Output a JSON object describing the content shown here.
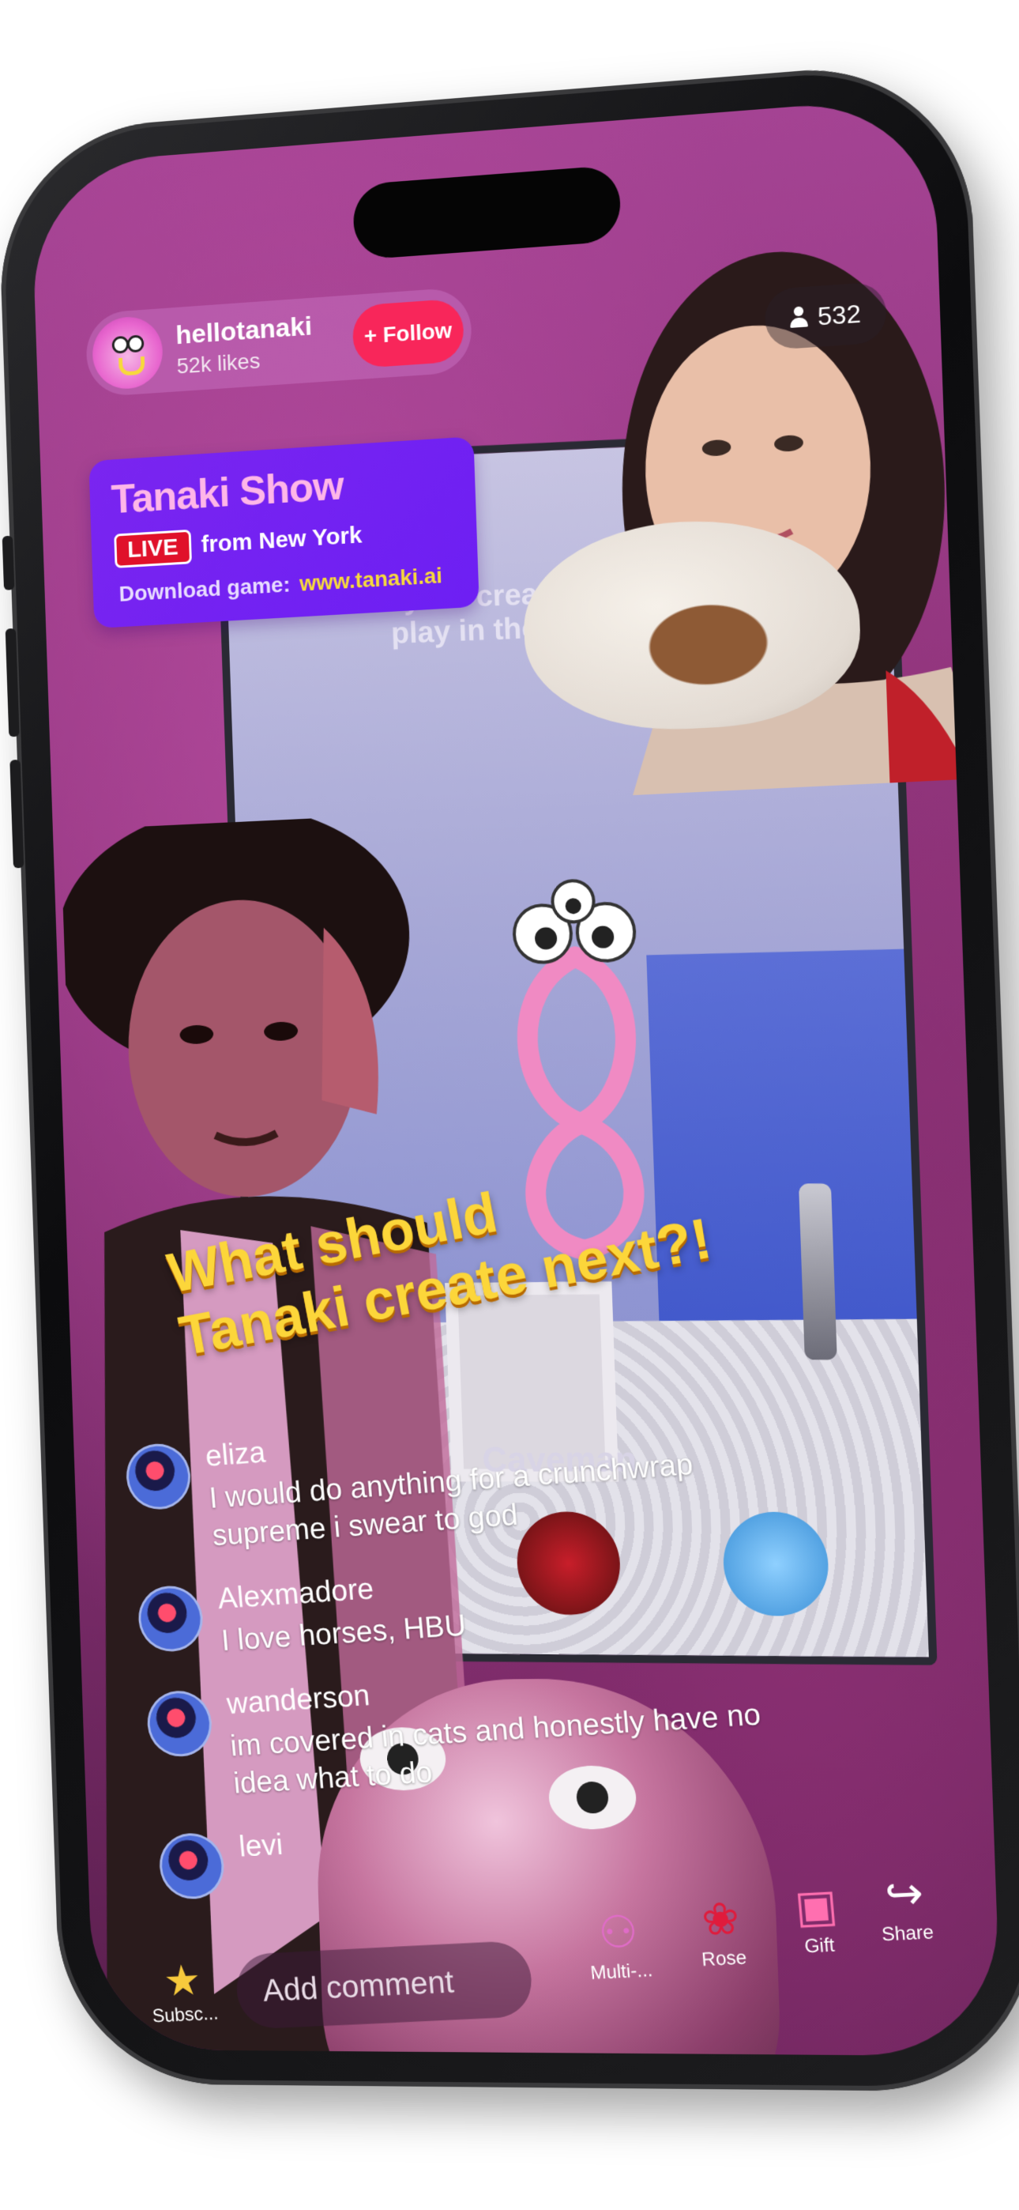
{
  "host": {
    "name": "hellotanaki",
    "likes": "52k likes",
    "follow_label": "+ Follow"
  },
  "viewers": {
    "count": "532",
    "icon": "person-icon"
  },
  "show_card": {
    "title": "Tanaki Show",
    "live_badge": "LIVE",
    "live_from": "from New York",
    "download_label": "Download game:",
    "download_link": "www.tanaki.ai"
  },
  "scene": {
    "tv_text_line1": "Let your creat",
    "tv_text_line2": "play in the",
    "caveman_label": "Caveman"
  },
  "headline": {
    "line1": "What should",
    "line2": "Tanaki create next?!"
  },
  "chat": {
    "messages": [
      {
        "user": "eliza",
        "text": "I would do anything for a crunchwrap supreme i swear to god"
      },
      {
        "user": "Alexmadore",
        "text": "I love horses, HBU"
      },
      {
        "user": "wanderson",
        "text": "im covered in cats and honestly have no idea what to do"
      },
      {
        "user": "levi",
        "text": ""
      }
    ]
  },
  "bottom_bar": {
    "subscribe_label": "Subsc...",
    "comment_placeholder": "Add comment",
    "actions": [
      {
        "label": "Multi-...",
        "icon": "multi-guest-icon"
      },
      {
        "label": "Rose",
        "icon": "rose-icon"
      },
      {
        "label": "Gift",
        "icon": "gift-icon"
      },
      {
        "label": "Share",
        "icon": "share-icon"
      }
    ]
  },
  "colors": {
    "follow": "#f8265a",
    "show_card": "#7a25f0",
    "live_badge": "#e0112a",
    "headline": "#fcd63a",
    "link": "#f7d93c"
  }
}
